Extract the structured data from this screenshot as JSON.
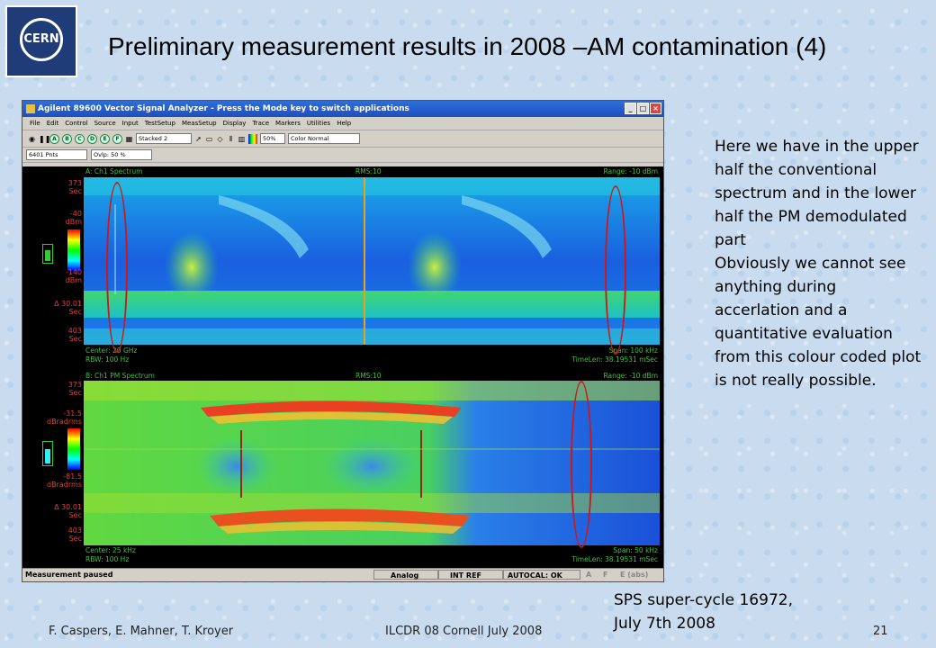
{
  "logo": {
    "text": "CERN"
  },
  "slide": {
    "title": "Preliminary measurement results in 2008 –AM contamination (4)",
    "description": [
      "Here we have in the upper half the conventional spectrum and in the lower half the PM demodulated part",
      "Obviously we cannot see anything during accerlation and a quantitative evaluation from this colour coded plot is not really possible."
    ],
    "caption_line1": "SPS super-cycle 16972,",
    "caption_line2": "July 7th 2008",
    "footer_left": "F. Caspers, E. Mahner, T. Kroyer",
    "footer_center": "ILCDR 08 Cornell July 2008",
    "footer_right": "21"
  },
  "window": {
    "title": "Agilent 89600 Vector Signal Analyzer - Press the Mode key to switch applications",
    "menu": [
      "File",
      "Edit",
      "Control",
      "Source",
      "Input",
      "TestSetup",
      "MeasSetup",
      "Display",
      "Trace",
      "Markers",
      "Utilities",
      "Help"
    ],
    "toolbar": {
      "traces": [
        "A",
        "B",
        "C",
        "D",
        "E",
        "F"
      ],
      "layout": "Stacked 2",
      "pct": "50%",
      "color_mode": "Color Normal",
      "points": "6401 Pnts",
      "overlap": "Ovlp: 50 %"
    },
    "status": {
      "message": "Measurement paused",
      "analog": "Analog",
      "intref": "INT REF",
      "autocal": "AUTOCAL: OK",
      "a": "A",
      "f": "F",
      "e": "E (abs)"
    }
  },
  "trace_a": {
    "header_left": "A: Ch1 Spectrum",
    "header_mid": "RMS:10",
    "header_right": "Range: -10 dBm",
    "time_top": "373",
    "time_top_unit": "Sec",
    "scale_top": "-40",
    "scale_top_unit": "dBm",
    "scale_bottom": "-140",
    "scale_bottom_unit": "dBm",
    "delta": "Δ 30.01",
    "delta_unit": "Sec",
    "time_bottom": "403",
    "time_bottom_unit": "Sec",
    "center": "Center: 20 GHz",
    "rbw": "RBW: 100 Hz",
    "span": "Span: 100 kHz",
    "timelen": "TimeLen: 38.19531 mSec"
  },
  "trace_b": {
    "header_left": "B: Ch1 PM Spectrum",
    "header_mid": "RMS:10",
    "header_right": "Range: -10 dBm",
    "time_top": "373",
    "time_top_unit": "Sec",
    "scale_top": "-31.5",
    "scale_top_unit": "dBradrms",
    "scale_bottom": "-81.5",
    "scale_bottom_unit": "dBradrms",
    "delta": "Δ 30.01",
    "delta_unit": "Sec",
    "time_bottom": "403",
    "time_bottom_unit": "Sec",
    "center": "Center: 25 kHz",
    "rbw": "RBW: 100 Hz",
    "span": "Span: 50 kHz",
    "timelen": "TimeLen: 38.19531 mSec"
  },
  "colors": {
    "annotation": "#cc1818",
    "scale_text": "#e04040",
    "info_text": "#40c040"
  }
}
